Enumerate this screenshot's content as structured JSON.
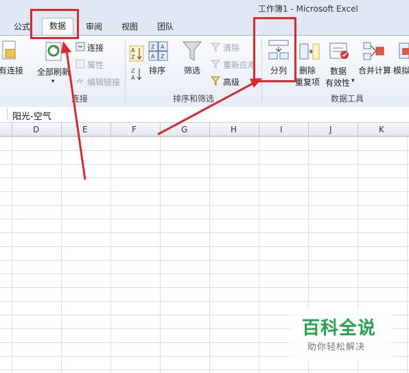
{
  "window": {
    "title": "工作簿1  -  Microsoft Excel"
  },
  "tabs": [
    {
      "label": "公式"
    },
    {
      "label": "数据",
      "active": true
    },
    {
      "label": "审阅"
    },
    {
      "label": "视图"
    },
    {
      "label": "团队"
    }
  ],
  "ribbon": {
    "existing_connections": "有连接",
    "refresh_all": "全部刷新",
    "connections": "连接",
    "properties": "属性",
    "edit_links": "编辑链接",
    "group_connections": "连接",
    "sort": "排序",
    "filter": "筛选",
    "clear": "清除",
    "reapply": "重新应用",
    "advanced": "高级",
    "group_sort_filter": "排序和筛选",
    "text_to_columns": "分列",
    "remove_dup_line1": "删除",
    "remove_dup_line2": "重复项",
    "validation_line1": "数据",
    "validation_line2": "有效性",
    "consolidate": "合并计算",
    "whatif": "模拟",
    "group_data_tools": "数据工具"
  },
  "formula_bar": {
    "value": "阳光-空气"
  },
  "columns": [
    "D",
    "E",
    "F",
    "G",
    "H",
    "I",
    "J",
    "K"
  ],
  "watermark": {
    "main": "百科全说",
    "sub": "助你轻松解决"
  },
  "colors": {
    "callout": "#e0262a",
    "watermark": "#24a34d",
    "ribbon": "#dfe8f3"
  },
  "icons": [
    "refresh-icon",
    "connection-icon",
    "sort-az-icon",
    "sort-za-icon",
    "sort-dialog-icon",
    "filter-funnel-icon",
    "clear-filter-icon",
    "reapply-icon",
    "advanced-filter-icon",
    "text-to-columns-icon",
    "remove-duplicates-icon",
    "data-validation-icon",
    "consolidate-icon",
    "what-if-icon"
  ]
}
